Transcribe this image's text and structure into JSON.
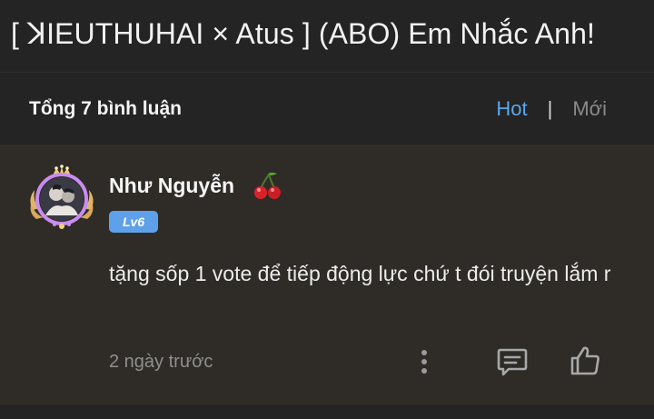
{
  "header": {
    "title": "[ ꓘIEUTHUHAI × Atus ] (ABO) Em Nhắc Anh!"
  },
  "comments_section": {
    "total_label": "Tổng 7 bình luận",
    "sort_options": [
      "Hot",
      "Mới"
    ],
    "sort_separator": "|",
    "active_sort": "Hot"
  },
  "comment": {
    "username": "Như Nguyễn",
    "name_emoji_icon": "cherry-icon",
    "level": "Lv6",
    "text": "tặng sốp 1 vote để tiếp động lực chứ t đói truyện lắm r",
    "time": "2 ngày trước",
    "actions": [
      "more-options-icon",
      "reply-icon",
      "like-icon"
    ]
  },
  "colors": {
    "background": "#242424",
    "comment_background": "#2f2c27",
    "accent_blue": "#5aa8ee",
    "badge_blue": "#5fa0ea",
    "muted_text": "#8f8f8f"
  }
}
